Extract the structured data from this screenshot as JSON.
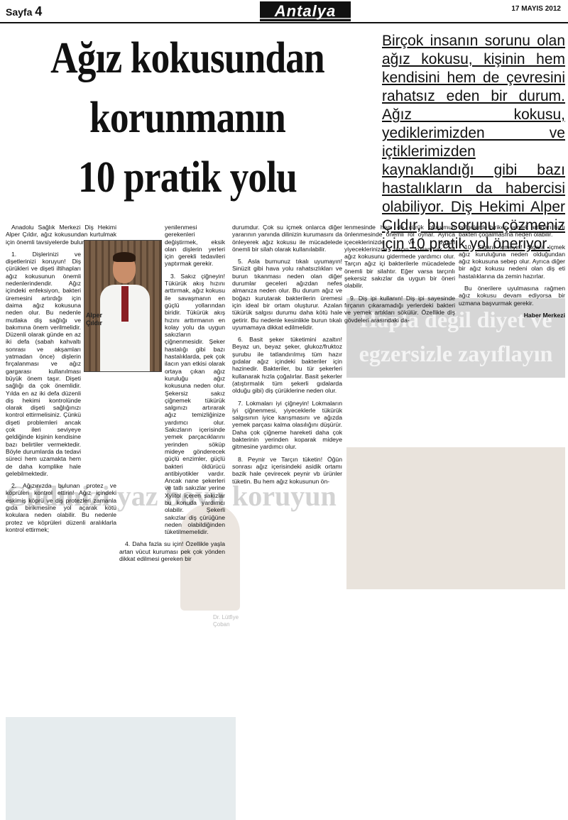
{
  "header": {
    "page_label": "Sayfa",
    "page_number": "4",
    "section": "Antalya",
    "date": "17 MAYIS 2012"
  },
  "article": {
    "headline_lines": [
      "Ağız kokusundan",
      "korunmanın",
      "10 pratik yolu"
    ],
    "intro": "Birçok insanın sorunu olan ağız kokusu, kişinin hem kendisini hem de çevresini rahatsız eden bir durum. Ağız kokusu, yediklerimizden ve içtiklerimizden kaynaklandığı gibi bazı hastalıkların da habercisi olabiliyor. Diş Hekimi Alper Çıldır, bu sorunu çözmeniz için 10 pratik yol öneriyor.",
    "photo_caption_line1": "Alper",
    "photo_caption_line2": "Çıldır",
    "col1": [
      "Anadolu Sağlık Merkezi Diş Hekimi Alper Çıldır, ağız kokusundan kurtulmak için önemli tavsiyelerde bulunuyor:",
      "1. Dişlerinizi ve dişetlerinizi koruyun! Diş çürükleri ve dişeti iltihapları ağız kokusunun önemli nedenlerindendir. Ağız içindeki enfeksiyon, bakteri üremesini artırdığı için daima ağız kokusuna neden olur. Bu nedenle mutlaka diş sağlığı ve bakımına önem verilmelidir. Düzenli olarak günde en az iki defa (sabah kahvaltı sonrası ve akşamları yatmadan önce) dişlerin fırçalanması ve ağız gargarası kullanılması büyük önem taşır. Dişeti sağlığı da çok önemlidir. Yılda en az iki defa düzenli diş hekimi kontrolünde olarak dişeti sağlığınızı kontrol ettirmelisiniz. Çünkü dişeti problemleri ancak çok ileri seviyeye geldiğinde kişinin kendisine bazı belirtiler vermektedir. Böyle durumlarda da tedavi süreci hem uzamakta hem de daha komplike hale gelebilmektedir.",
      "2. Ağızınızda bulunan protez ve köprüleri kontrol ettirin! Ağız içindeki eskimiş köprü ve diş protezleri zamanla gıda birikmesine yol açarak kötü kokulara neden olabilir. Bu nedenle protez ve köprüleri düzenli aralıklarla kontrol ettirmek;"
    ],
    "col2": [
      "yenilenmesi gerekenleri değiştirmek, eksik olan dişlerin yerleri için gerekli tedavileri yaptırmak gerekir.",
      "3. Sakız çiğneyin! Tükürük akış hızını arttırmak, ağız kokusu ile savaşmanın en güçlü yollarından biridir. Tükürük akış hızını arttırmanın en kolay yolu da uygun sakızların çiğnenmesidir. Şeker hastalığı gibi bazı hastalıklarda, pek çok ilacın yan etkisi olarak ortaya çıkan ağız kuruluğu ağız kokusuna neden olur. Şekersiz sakız çiğnemek tükürük salgınızı artırarak ağız temizliğinize yardımcı olur. Sakızların içerisinde yemek parçacıklarını yerinden söküp mideye gönderecek güçlü enzimler, güçlü bakteri öldürücü antibiyotikler vardır. Ancak nane şekerleri ve tatlı sakızlar yerine Xylitol içeren sakızlar bu konuda yardımcı olabilir. Şekerli sakızlar diş çürüğüne neden olabildiğinden tüketilmemelidir.",
      "4. Daha fazla su için! Özellikle yaşla artan vücut kuruması pek çok yönden dikkat edilmesi gereken bir"
    ],
    "col3": [
      "durumdur. Çok su içmek onlarca diğer yararının yanında dilinizin kurumasını da önleyerek ağız kokusu ile mücadelede önemli bir silah olarak kullanılabilir.",
      "5. Asla burnunuz tıkalı uyumayın! Sinüzit gibi hava yolu rahatsızlıkları ve burun tıkanması neden olan diğer durumlar geceleri ağızdan nefes almanıza neden olur. Bu durum ağız ve boğazı kurutarak bakterilerin üremesi için ideal bir ortam oluşturur. Azalan tükürük salgısı durumu daha kötü hale getirir. Bu nedenle kesinlikle burun tıkalı uyumamaya dikkat edilmelidir.",
      "6. Basit şeker tüketimini azaltın! Beyaz un, beyaz şeker, glukoz/fruktoz şurubu ile tatlandırılmış tüm hazır gıdalar ağız içindeki bakteriler için hazinedir. Bakteriler, bu tür şekerleri kullanarak hızla çoğalırlar. Basit şekerler (atıştırmalık tüm şekerli gıdalarda olduğu gibi) diş çürüklerine neden olur.",
      "7. Lokmaları iyi çiğneyin! Lokmaların iyi çiğnenmesi, yiyeceklerle tükürük salgısının iyice karışmasını ve ağızda yemek parçası kalma olasılığını düşürür. Daha çok çiğneme hareketi daha çok bakterinin yerinden koparak mideye gitmesine yardımcı olur.",
      "8. Peynir ve Tarçın tüketin! Öğün sonrası ağız içerisindeki asidik ortamı bazik hale çevirecek peynir vb ürünler tüketin. Bu hem ağız kokusunun ön-"
    ],
    "col4": [
      "lenmesinde hem de çürük oluşumun önlenmesinde önemli rol oynar. Ayrıca içeceklerinizde ve uygun yiyeceklerinizde tarçın kullanmak da ağız kokusunu gidermede yardımcı olur. Tarçın ağız içi bakterilerle mücadelede önemli bir silahtır. Eğer varsa tarçınlı şekersiz sakızlar da uygun bir öneri olabilir.",
      "9. Diş ipi kullanın! Diş ipi sayesinde fırçanın çıkaramadığı yerlerdeki bakteri ve yemek artıkları sökülür. Özellikle diş gövdeleri arasındaki da-"
    ],
    "col5": [
      "bölgelerde biriken yemek artıkları hızlı bakteri çoğalmasına neden olabilir.",
      "10. Sigara içmeyin! Sigara içmek ağız kuruluğuna neden olduğundan ağız kokusuna sebep olur. Ayrıca diğer bir ağız kokusu nedeni olan diş eti hastalıklarına da zemin hazırlar.",
      "Bu önerilere uyulmasına rağmen ağız kokusu devam ediyorsa bir uzmana başvurmak gerekir."
    ],
    "byline": "Haber Merkezi"
  },
  "faded": {
    "hapla_title": "Hapla değil diyet ve egzersizle zayıflayın",
    "cildi_title": "Cildinizi yaz boyu koruyun",
    "doctor_name_line1": "Dr. Lütfiye",
    "doctor_name_line2": "Çoban"
  }
}
